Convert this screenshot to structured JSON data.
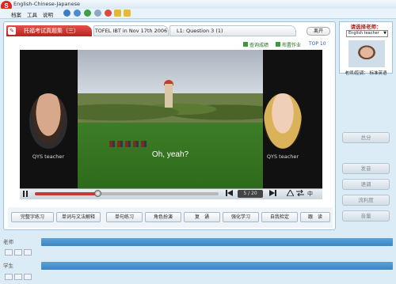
{
  "window": {
    "title": "English-Chinese-Japanese",
    "logo": "S"
  },
  "menu": {
    "items": [
      "档案",
      "工具",
      "说明"
    ]
  },
  "toolbar_icons": [
    "back-icon",
    "home-icon",
    "refresh-icon",
    "stop-icon",
    "close-icon",
    "folder-icon",
    "favorite-icon"
  ],
  "tabs": {
    "book": "托福考试真题集（三）",
    "test": "TOFEL IBT in Nov 17th 2006",
    "question": "L1: Question 3 (1)",
    "leave": "离开"
  },
  "top_links": {
    "query": "查询成绩",
    "assignment": "布置作业",
    "top10": "TOP 10"
  },
  "video": {
    "subtitle": "Oh, yeah?",
    "left_label": "QYS teacher",
    "right_label": "QYS teacher",
    "counter": "5 / 20",
    "progress_fraction": 0.34
  },
  "player_controls": [
    "play-icon",
    "prev-icon",
    "next-icon",
    "font-size-icon",
    "swap-icon",
    "chinese-toggle-icon"
  ],
  "player_control_text": {
    "chinese": "中"
  },
  "function_buttons": [
    {
      "label": "完整字练习"
    },
    {
      "label": "单词与文法解释"
    },
    {
      "label": "单句练习"
    },
    {
      "label": "角色扮演"
    },
    {
      "label": "复　诵"
    },
    {
      "label": "强化学习"
    },
    {
      "label": "自我检定"
    },
    {
      "label": "跟　读"
    }
  ],
  "teacher_panel": {
    "title": "请选择老师：",
    "selected": "English teacher",
    "caption": "老师/腔调： 标准英语"
  },
  "right_buttons": [
    "总分",
    "发音",
    "语调",
    "流利度",
    "音量"
  ],
  "bottom": {
    "teacher_label": "老师",
    "student_label": "学生"
  }
}
